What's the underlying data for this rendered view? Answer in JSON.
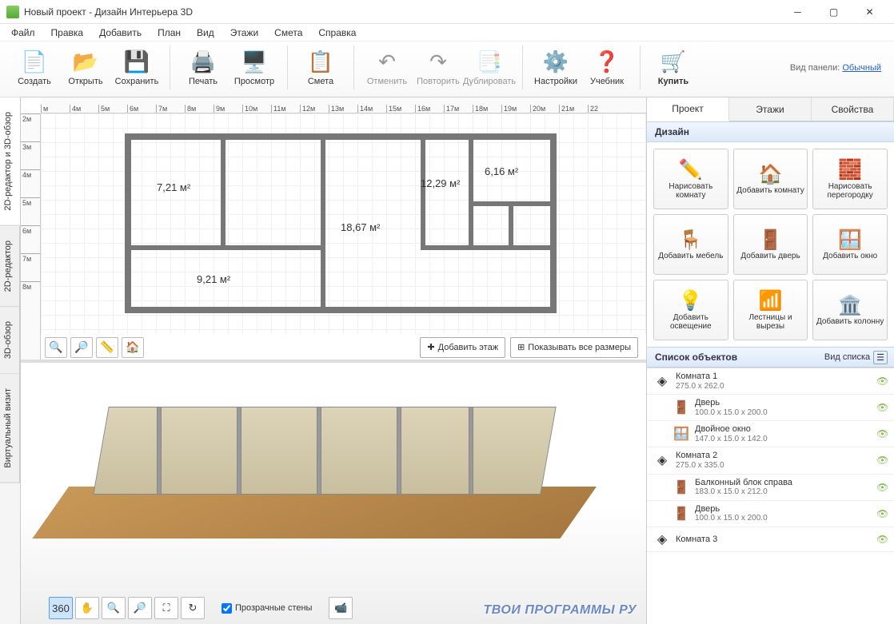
{
  "window": {
    "title": "Новый проект - Дизайн Интерьера 3D"
  },
  "menu": [
    "Файл",
    "Правка",
    "Добавить",
    "План",
    "Вид",
    "Этажи",
    "Смета",
    "Справка"
  ],
  "toolbar": {
    "create": "Создать",
    "open": "Открыть",
    "save": "Сохранить",
    "print": "Печать",
    "preview": "Просмотр",
    "estimate": "Смета",
    "undo": "Отменить",
    "redo": "Повторить",
    "duplicate": "Дублировать",
    "settings": "Настройки",
    "tutorial": "Учебник",
    "buy": "Купить"
  },
  "panel_type": {
    "label": "Вид панели:",
    "value": "Обычный"
  },
  "side_tabs": [
    "2D-редактор и 3D-обзор",
    "2D-редактор",
    "3D-обзор",
    "Виртуальный визит"
  ],
  "ruler_h": [
    "м",
    "4м",
    "5м",
    "6м",
    "7м",
    "8м",
    "9м",
    "10м",
    "11м",
    "12м",
    "13м",
    "14м",
    "15м",
    "16м",
    "17м",
    "18м",
    "19м",
    "20м",
    "21м",
    "22"
  ],
  "ruler_v": [
    "2м",
    "3м",
    "4м",
    "5м",
    "6м",
    "7м",
    "8м"
  ],
  "rooms": {
    "r1": "7,21 м²",
    "r2": "18,67 м²",
    "r3": "12,29 м²",
    "r4": "6,16 м²",
    "r5": "9,21 м²"
  },
  "plan_actions": {
    "add_floor": "Добавить этаж",
    "show_all": "Показывать все размеры"
  },
  "view3d": {
    "transparent": "Прозрачные стены",
    "camera_label": ""
  },
  "right_tabs": [
    "Проект",
    "Этажи",
    "Свойства"
  ],
  "design_header": "Дизайн",
  "design_buttons": [
    {
      "k": "draw_room",
      "l": "Нарисовать комнату",
      "i": "✏️"
    },
    {
      "k": "add_room",
      "l": "Добавить комнату",
      "i": "🏠"
    },
    {
      "k": "draw_partition",
      "l": "Нарисовать перегородку",
      "i": "🧱"
    },
    {
      "k": "add_furniture",
      "l": "Добавить мебель",
      "i": "🪑"
    },
    {
      "k": "add_door",
      "l": "Добавить дверь",
      "i": "🚪"
    },
    {
      "k": "add_window",
      "l": "Добавить окно",
      "i": "🪟"
    },
    {
      "k": "add_light",
      "l": "Добавить освещение",
      "i": "💡"
    },
    {
      "k": "stairs",
      "l": "Лестницы и вырезы",
      "i": "📶"
    },
    {
      "k": "add_column",
      "l": "Добавить колонну",
      "i": "🏛️"
    }
  ],
  "objects_header": "Список объектов",
  "list_view_label": "Вид списка",
  "objects": [
    {
      "name": "Комната 1",
      "dim": "275.0 x 262.0",
      "ico": "◈",
      "child": false
    },
    {
      "name": "Дверь",
      "dim": "100.0 x 15.0 x 200.0",
      "ico": "🚪",
      "child": true
    },
    {
      "name": "Двойное окно",
      "dim": "147.0 x 15.0 x 142.0",
      "ico": "🪟",
      "child": true
    },
    {
      "name": "Комната 2",
      "dim": "275.0 x 335.0",
      "ico": "◈",
      "child": false
    },
    {
      "name": "Балконный блок справа",
      "dim": "183.0 x 15.0 x 212.0",
      "ico": "🚪",
      "child": true
    },
    {
      "name": "Дверь",
      "dim": "100.0 x 15.0 x 200.0",
      "ico": "🚪",
      "child": true
    },
    {
      "name": "Комната 3",
      "dim": "",
      "ico": "◈",
      "child": false
    }
  ],
  "watermark": "ТВОИ ПРОГРАММЫ РУ"
}
